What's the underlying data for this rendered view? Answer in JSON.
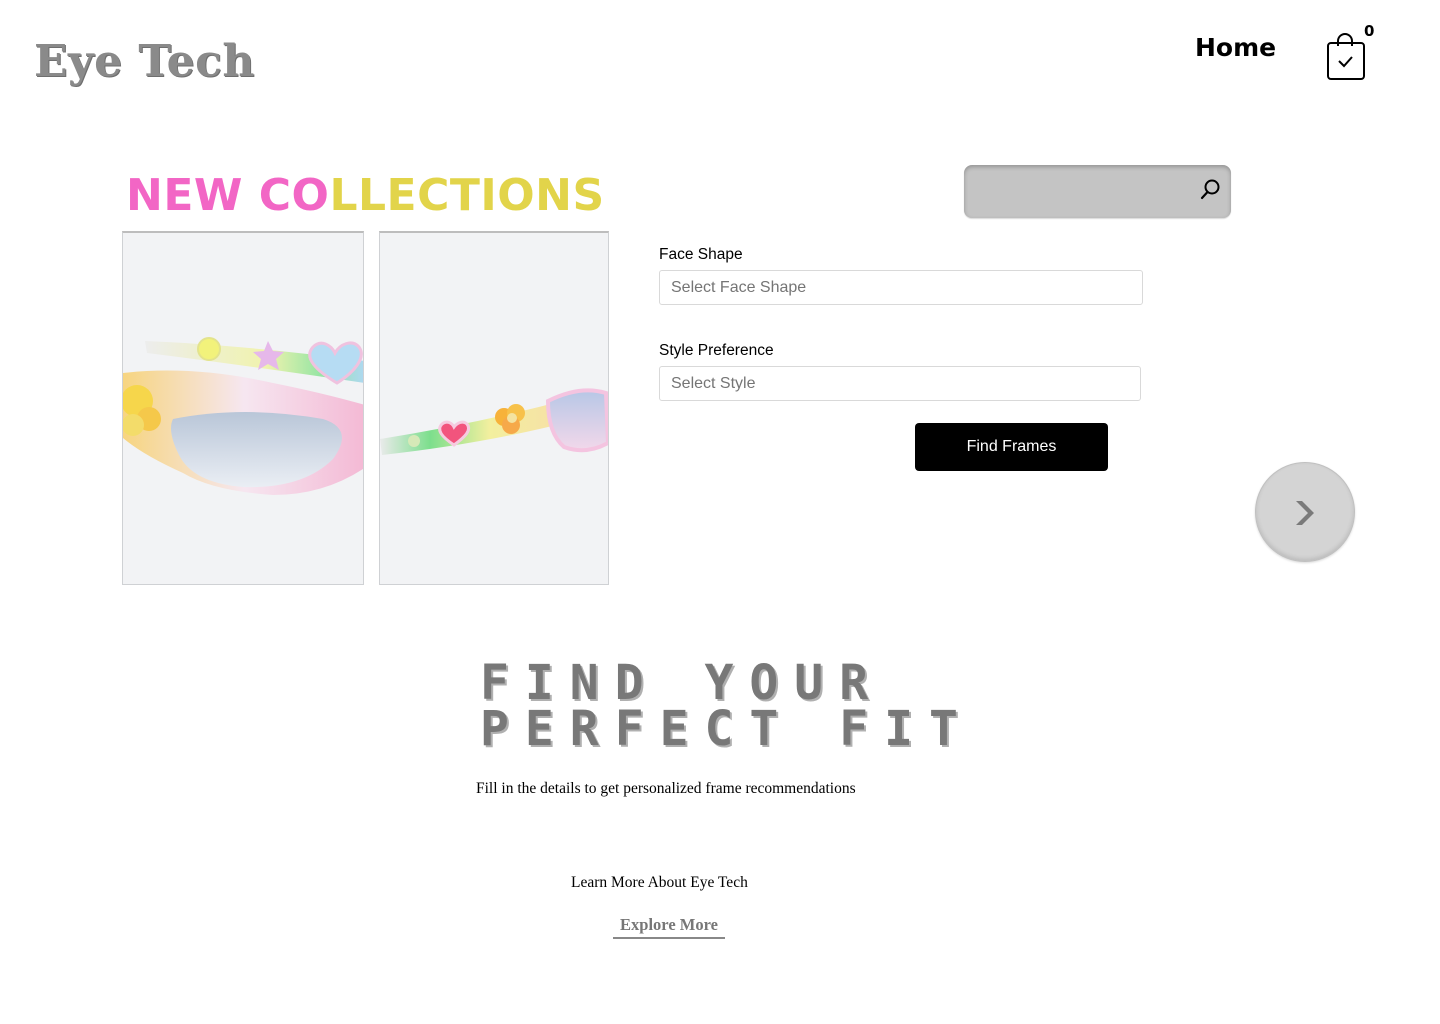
{
  "brand": {
    "logo_text": "Eye Tech"
  },
  "nav": {
    "home_label": "Home",
    "cart_count": "0",
    "cart_icon": "shopping-bag-check-icon"
  },
  "collections": {
    "title_part1": "NEW CO",
    "title_part2": "LLECTIONS",
    "colors": {
      "pink": "#f266c5",
      "yellow": "#e2d44a"
    },
    "products": [
      {
        "name": "pastel-sunglasses-front"
      },
      {
        "name": "pastel-sunglasses-side"
      }
    ]
  },
  "search": {
    "placeholder": "",
    "value": "",
    "icon": "search-icon"
  },
  "form": {
    "face_shape": {
      "label": "Face Shape",
      "placeholder": "Select Face Shape"
    },
    "style_preference": {
      "label": "Style Preference",
      "placeholder": "Select Style"
    },
    "submit_label": "Find Frames"
  },
  "carousel": {
    "next_icon": "chevron-right-icon"
  },
  "fit": {
    "heading_line1": "FIND YOUR",
    "heading_line2": "PERFECT FIT",
    "subtitle": "Fill in the details to get personalized frame recommendations"
  },
  "footer": {
    "learn_more": "Learn More About Eye Tech",
    "explore_label": "Explore More"
  }
}
